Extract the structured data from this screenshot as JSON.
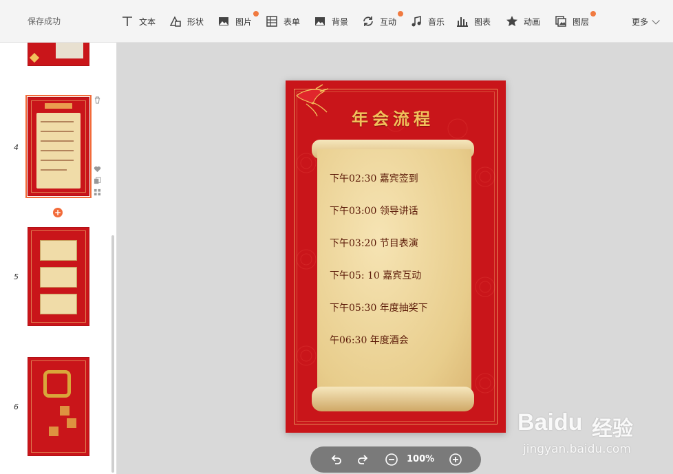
{
  "toolbar": {
    "save_status": "保存成功",
    "tools": [
      {
        "label": "文本",
        "icon": "text-icon"
      },
      {
        "label": "形状",
        "icon": "shape-icon"
      },
      {
        "label": "图片",
        "icon": "image-icon"
      },
      {
        "label": "表单",
        "icon": "form-icon"
      },
      {
        "label": "背景",
        "icon": "background-icon"
      },
      {
        "label": "互动",
        "icon": "interaction-icon"
      },
      {
        "label": "音乐",
        "icon": "music-icon"
      },
      {
        "label": "图表",
        "icon": "chart-icon"
      },
      {
        "label": "动画",
        "icon": "animation-icon"
      },
      {
        "label": "图层",
        "icon": "layer-icon"
      }
    ],
    "more": "更多",
    "accent_dot_color": "#f07a40"
  },
  "sidebar": {
    "pages": [
      {
        "num": "4"
      },
      {
        "num": "5"
      },
      {
        "num": "6"
      }
    ],
    "add_label": "+"
  },
  "slide": {
    "title": "年会流程",
    "schedule": [
      "下午02:30 嘉宾签到",
      "下午03:00 领导讲话",
      "下午03:20 节目表演",
      "下午05: 10 嘉宾互动",
      "下午05:30 年度抽奖下",
      "午06:30 年度酒会"
    ],
    "bg_color": "#c9151a",
    "text_color": "#5b1a08",
    "title_color": "#f2c15c"
  },
  "zoom": {
    "value": "100%"
  },
  "watermark": {
    "logo": "Baidu",
    "cn": "经验",
    "url": "jingyan.baidu.com"
  }
}
